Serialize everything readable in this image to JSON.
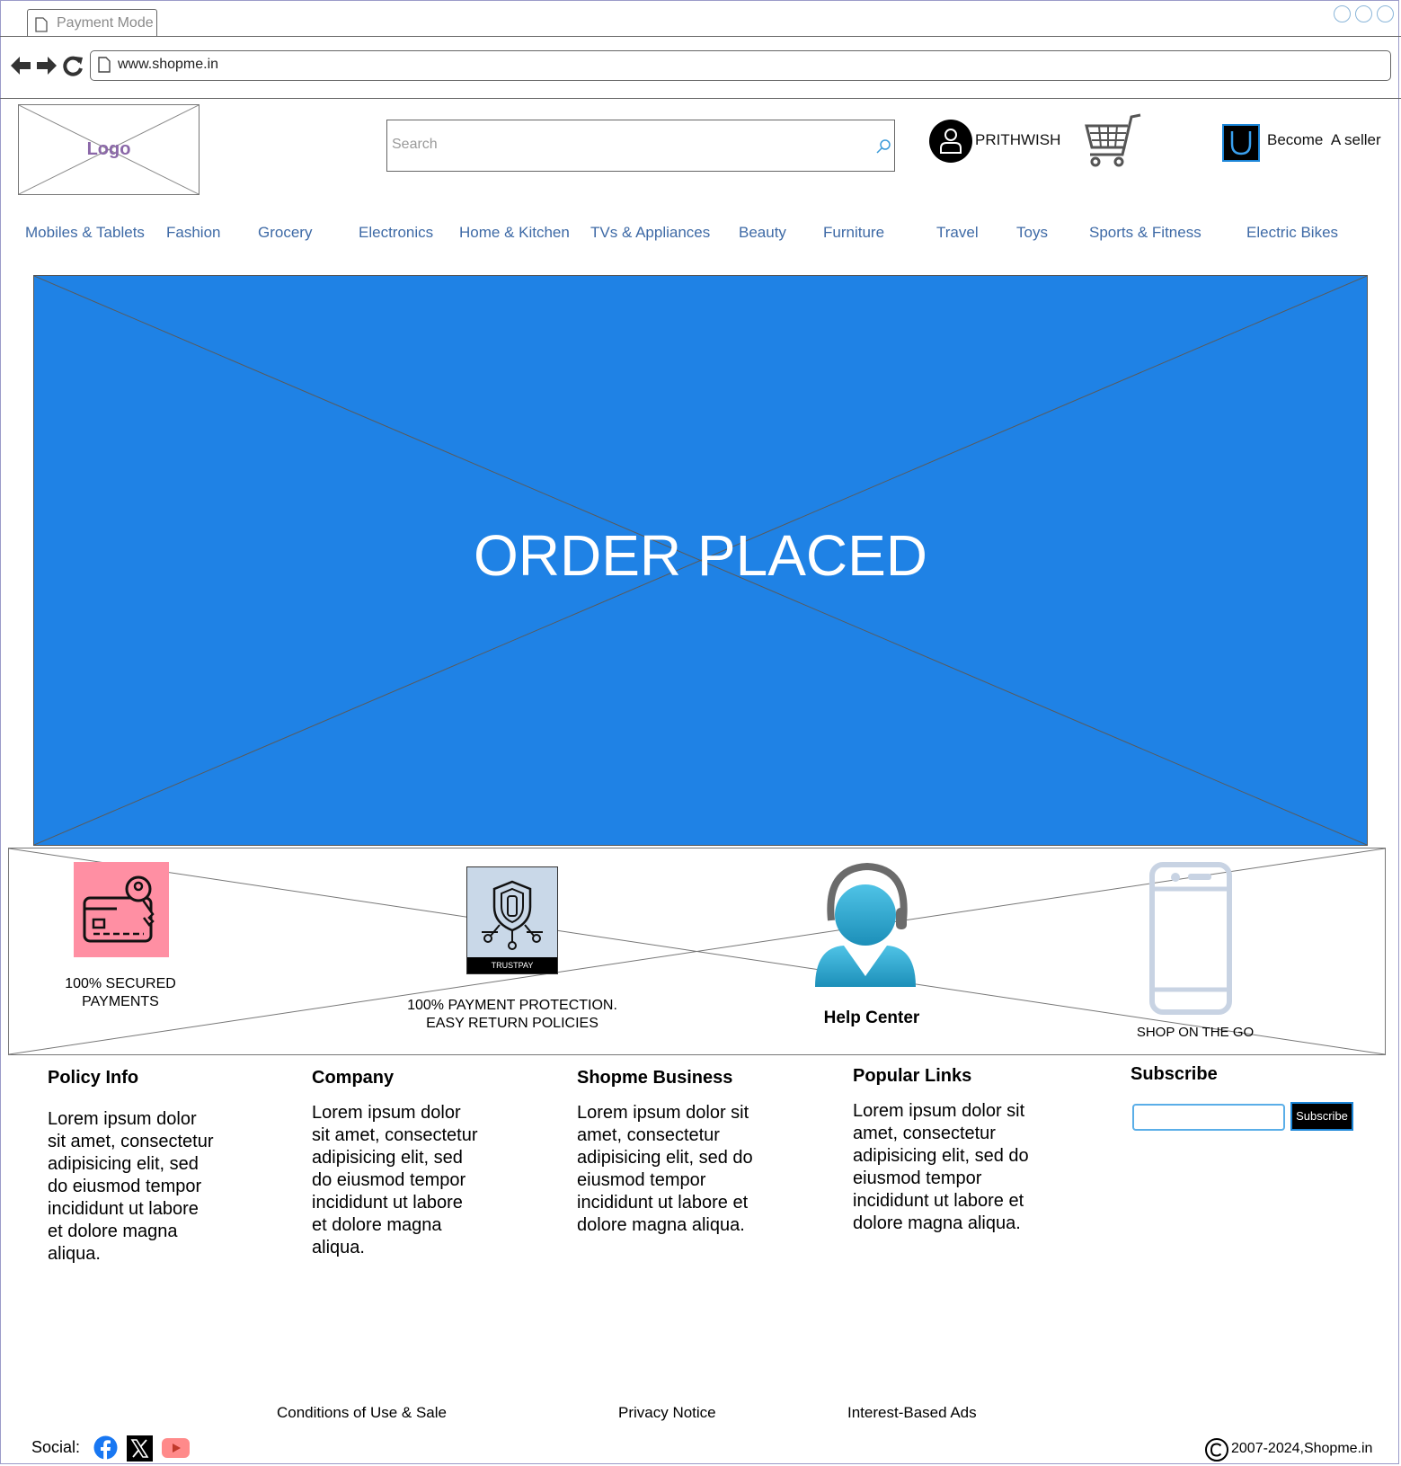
{
  "browser": {
    "tab_title": "Payment Mode",
    "url": "www.shopme.in"
  },
  "header": {
    "logo_label": "Logo",
    "search_placeholder": "Search",
    "username": "PRITHWISH",
    "seller_label": "Become  A seller"
  },
  "nav": {
    "items": [
      "Mobiles & Tablets",
      "Fashion",
      "Grocery",
      "Electronics",
      "Home & Kitchen",
      "TVs & Appliances",
      "Beauty",
      "Furniture",
      "Travel",
      "Toys",
      "Sports & Fitness",
      "Electric Bikes"
    ]
  },
  "hero": {
    "text": "ORDER PLACED"
  },
  "features": {
    "secured_line1": "100% SECURED",
    "secured_line2": "PAYMENTS",
    "trustpay_badge": "TRUSTPAY",
    "protection_line1": "100% PAYMENT PROTECTION.",
    "protection_line2": "EASY RETURN POLICIES",
    "help_center": "Help Center",
    "shop_on_go": "SHOP ON THE GO"
  },
  "footer": {
    "columns": [
      {
        "title": "Policy Info",
        "text": "Lorem ipsum dolor sit amet, consectetur adipisicing elit, sed do eiusmod tempor incididunt ut labore et dolore magna aliqua."
      },
      {
        "title": "Company",
        "text": "Lorem ipsum dolor sit amet, consectetur adipisicing elit, sed do eiusmod tempor incididunt ut labore et dolore magna aliqua."
      },
      {
        "title": "Shopme Business",
        "text": "Lorem ipsum dolor sit amet, consectetur adipisicing elit, sed do eiusmod tempor incididunt ut labore et dolore magna aliqua."
      },
      {
        "title": "Popular Links",
        "text": "Lorem ipsum dolor sit amet, consectetur adipisicing elit, sed do eiusmod tempor incididunt ut labore et dolore magna aliqua."
      }
    ],
    "subscribe_title": "Subscribe",
    "subscribe_button": "Subscribe",
    "links": {
      "conditions": "Conditions of Use & Sale",
      "privacy": "Privacy Notice",
      "ads": "Interest-Based Ads"
    },
    "social_label": "Social:",
    "copyright": "2007-2024,Shopme.in"
  },
  "colors": {
    "hero_bg": "#1f82e5",
    "nav_link": "#3e6aa6",
    "secured_bg": "#ff8fa3",
    "help_icon": "#2aa6cf"
  }
}
